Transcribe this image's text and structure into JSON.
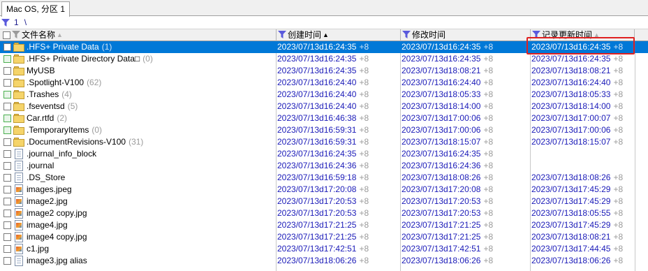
{
  "tab": {
    "label": "Mac OS, 分区 1"
  },
  "path": {
    "segment": "1",
    "separator": "\\"
  },
  "columns": {
    "name": "文件名称",
    "created": "创建时间",
    "modified": "修改时间",
    "record": "记录更新时间"
  },
  "rows": [
    {
      "name": ".HFS+ Private Data",
      "count": "(1)",
      "icon": "folder-icon",
      "check": "plain",
      "created": "2023/07/13d16:24:35",
      "created_tz": "+8",
      "modified": "2023/07/13d16:24:35",
      "modified_tz": "+8",
      "record": "2023/07/13d16:24:35",
      "record_tz": "+8"
    },
    {
      "name": ".HFS+ Private Directory Data\u0000",
      "count": "(0)",
      "icon": "folder-icon",
      "check": "green",
      "created": "2023/07/13d16:24:35",
      "created_tz": "+8",
      "modified": "2023/07/13d16:24:35",
      "modified_tz": "+8",
      "record": "2023/07/13d16:24:35",
      "record_tz": "+8"
    },
    {
      "name": "MyUSB",
      "count": "",
      "icon": "folder-icon",
      "check": "plain",
      "created": "2023/07/13d16:24:35",
      "created_tz": "+8",
      "modified": "2023/07/13d18:08:21",
      "modified_tz": "+8",
      "record": "2023/07/13d18:08:21",
      "record_tz": "+8"
    },
    {
      "name": ".Spotlight-V100",
      "count": "(62)",
      "icon": "folder-icon",
      "check": "plain",
      "created": "2023/07/13d16:24:40",
      "created_tz": "+8",
      "modified": "2023/07/13d16:24:40",
      "modified_tz": "+8",
      "record": "2023/07/13d16:24:40",
      "record_tz": "+8"
    },
    {
      "name": ".Trashes",
      "count": "(4)",
      "icon": "folder-icon",
      "check": "green",
      "created": "2023/07/13d16:24:40",
      "created_tz": "+8",
      "modified": "2023/07/13d18:05:33",
      "modified_tz": "+8",
      "record": "2023/07/13d18:05:33",
      "record_tz": "+8"
    },
    {
      "name": ".fseventsd",
      "count": "(5)",
      "icon": "folder-icon",
      "check": "plain",
      "created": "2023/07/13d16:24:40",
      "created_tz": "+8",
      "modified": "2023/07/13d18:14:00",
      "modified_tz": "+8",
      "record": "2023/07/13d18:14:00",
      "record_tz": "+8"
    },
    {
      "name": "Car.rtfd",
      "count": "(2)",
      "icon": "folder-icon",
      "check": "green",
      "created": "2023/07/13d16:46:38",
      "created_tz": "+8",
      "modified": "2023/07/13d17:00:06",
      "modified_tz": "+8",
      "record": "2023/07/13d17:00:07",
      "record_tz": "+8"
    },
    {
      "name": ".TemporaryItems",
      "count": "(0)",
      "icon": "folder-icon",
      "check": "green",
      "created": "2023/07/13d16:59:31",
      "created_tz": "+8",
      "modified": "2023/07/13d17:00:06",
      "modified_tz": "+8",
      "record": "2023/07/13d17:00:06",
      "record_tz": "+8"
    },
    {
      "name": ".DocumentRevisions-V100",
      "count": "(31)",
      "icon": "folder-icon",
      "check": "plain",
      "created": "2023/07/13d16:59:31",
      "created_tz": "+8",
      "modified": "2023/07/13d18:15:07",
      "modified_tz": "+8",
      "record": "2023/07/13d18:15:07",
      "record_tz": "+8"
    },
    {
      "name": ".journal_info_block",
      "count": "",
      "icon": "file-icon",
      "check": "plain",
      "created": "2023/07/13d16:24:35",
      "created_tz": "+8",
      "modified": "2023/07/13d16:24:35",
      "modified_tz": "+8",
      "record": "",
      "record_tz": ""
    },
    {
      "name": ".journal",
      "count": "",
      "icon": "file-icon",
      "check": "plain",
      "created": "2023/07/13d16:24:36",
      "created_tz": "+8",
      "modified": "2023/07/13d16:24:36",
      "modified_tz": "+8",
      "record": "",
      "record_tz": ""
    },
    {
      "name": ".DS_Store",
      "count": "",
      "icon": "file-icon",
      "check": "plain",
      "created": "2023/07/13d16:59:18",
      "created_tz": "+8",
      "modified": "2023/07/13d18:08:26",
      "modified_tz": "+8",
      "record": "2023/07/13d18:08:26",
      "record_tz": "+8"
    },
    {
      "name": "images.jpeg",
      "count": "",
      "icon": "image-icon",
      "check": "plain",
      "created": "2023/07/13d17:20:08",
      "created_tz": "+8",
      "modified": "2023/07/13d17:20:08",
      "modified_tz": "+8",
      "record": "2023/07/13d17:45:29",
      "record_tz": "+8"
    },
    {
      "name": "image2.jpg",
      "count": "",
      "icon": "image-icon",
      "check": "plain",
      "created": "2023/07/13d17:20:53",
      "created_tz": "+8",
      "modified": "2023/07/13d17:20:53",
      "modified_tz": "+8",
      "record": "2023/07/13d17:45:29",
      "record_tz": "+8"
    },
    {
      "name": "image2 copy.jpg",
      "count": "",
      "icon": "image-icon",
      "check": "plain",
      "created": "2023/07/13d17:20:53",
      "created_tz": "+8",
      "modified": "2023/07/13d17:20:53",
      "modified_tz": "+8",
      "record": "2023/07/13d18:05:55",
      "record_tz": "+8"
    },
    {
      "name": "image4.jpg",
      "count": "",
      "icon": "image-icon",
      "check": "plain",
      "created": "2023/07/13d17:21:25",
      "created_tz": "+8",
      "modified": "2023/07/13d17:21:25",
      "modified_tz": "+8",
      "record": "2023/07/13d17:45:29",
      "record_tz": "+8"
    },
    {
      "name": "image4 copy.jpg",
      "count": "",
      "icon": "image-icon",
      "check": "plain",
      "created": "2023/07/13d17:21:25",
      "created_tz": "+8",
      "modified": "2023/07/13d17:21:25",
      "modified_tz": "+8",
      "record": "2023/07/13d18:08:21",
      "record_tz": "+8"
    },
    {
      "name": "c1.jpg",
      "count": "",
      "icon": "image-icon",
      "check": "plain",
      "created": "2023/07/13d17:42:51",
      "created_tz": "+8",
      "modified": "2023/07/13d17:42:51",
      "modified_tz": "+8",
      "record": "2023/07/13d17:44:45",
      "record_tz": "+8"
    },
    {
      "name": "image3.jpg alias",
      "count": "",
      "icon": "file-icon",
      "check": "plain",
      "created": "2023/07/13d18:06:26",
      "created_tz": "+8",
      "modified": "2023/07/13d18:06:26",
      "modified_tz": "+8",
      "record": "2023/07/13d18:06:26",
      "record_tz": "+8"
    }
  ],
  "selected_row": 0
}
